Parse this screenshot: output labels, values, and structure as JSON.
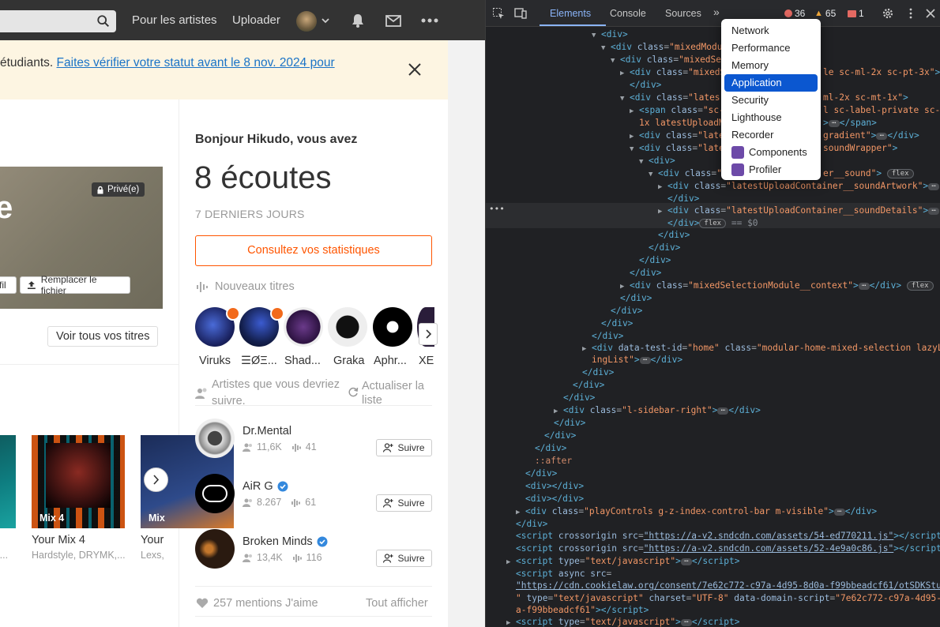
{
  "topbar": {
    "nav_artists": "Pour les artistes",
    "nav_upload": "Uploader",
    "icons": [
      "search-icon",
      "chevron-down-icon",
      "bell-icon",
      "mail-icon",
      "more-icon"
    ]
  },
  "banner": {
    "text_prefix": "étudiants. ",
    "link_text": "Faites vérifier votre statut avant le 8 nov. 2024 pour"
  },
  "track": {
    "art_letter": "e",
    "private_label": "Privé(e)",
    "profile_btn": "fil",
    "replace_btn": "Remplacer le fichier",
    "see_all": "Voir tous vos titres"
  },
  "mixes": [
    {
      "label": "",
      "title": "",
      "sub": "Z..."
    },
    {
      "label": "Mix 4",
      "title": "Your Mix 4",
      "sub": "Hardstyle, DRYMK,..."
    },
    {
      "label": "Mix",
      "title": "Your",
      "sub": "Lexs,"
    }
  ],
  "stats": {
    "greeting": "Bonjour Hikudo, vous avez",
    "plays": "8 écoutes",
    "period": "7 DERNIERS JOURS",
    "button": "Consultez vos statistiques"
  },
  "new_tracks": {
    "title": "Nouveaux titres",
    "artists": [
      "Viruks",
      "☰ØΞ...",
      "Shad...",
      "Graka",
      "Aphr...",
      "XE"
    ]
  },
  "suggestions": {
    "title": "Artistes que vous devriez suivre.",
    "refresh": "Actualiser la liste",
    "follow_label": "Suivre",
    "items": [
      {
        "name": "Dr.Mental",
        "followers": "11,6K",
        "tracks": "41",
        "verified": false
      },
      {
        "name": "AiR G",
        "followers": "8.267",
        "tracks": "61",
        "verified": true
      },
      {
        "name": "Broken Minds",
        "followers": "13,4K",
        "tracks": "116",
        "verified": true
      }
    ]
  },
  "likes": {
    "count_label": "257 mentions J'aime",
    "see_all": "Tout afficher"
  },
  "devtools": {
    "tabs": [
      "Elements",
      "Console",
      "Sources"
    ],
    "errors": "36",
    "warnings": "65",
    "issues": "1",
    "menu_items": [
      "Network",
      "Performance",
      "Memory",
      "Application",
      "Security",
      "Lighthouse",
      "Recorder",
      "Components",
      "Profiler"
    ],
    "active_menu": "Application",
    "selected_suffix": "== $0",
    "colors": {
      "accent": "#8ab4f8",
      "menu_active": "#0b57d0",
      "brand": "#ff5500"
    }
  }
}
